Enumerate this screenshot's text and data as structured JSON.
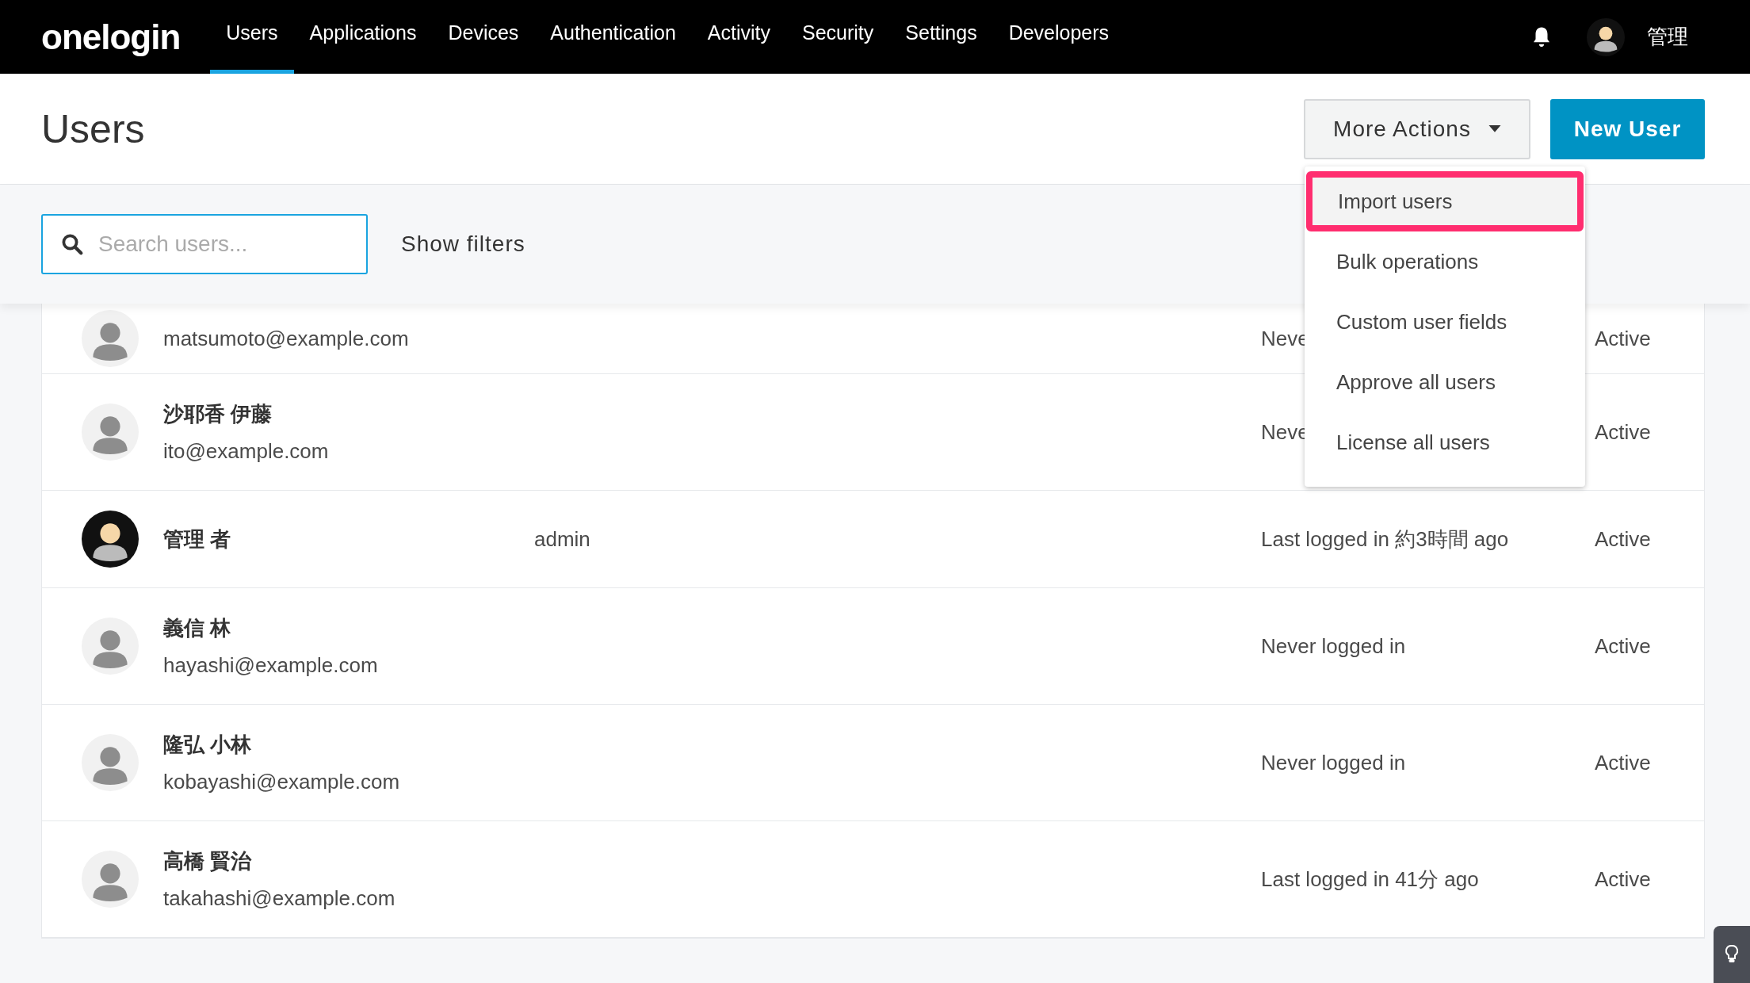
{
  "nav": {
    "logo": "onelogin",
    "items": [
      {
        "label": "Users",
        "selected": true
      },
      {
        "label": "Applications",
        "selected": false
      },
      {
        "label": "Devices",
        "selected": false
      },
      {
        "label": "Authentication",
        "selected": false
      },
      {
        "label": "Activity",
        "selected": false
      },
      {
        "label": "Security",
        "selected": false
      },
      {
        "label": "Settings",
        "selected": false
      },
      {
        "label": "Developers",
        "selected": false
      }
    ],
    "account": {
      "name": "管理",
      "kind": "illustrated"
    }
  },
  "header": {
    "title": "Users",
    "more_actions": "More Actions",
    "new_user": "New User"
  },
  "dropdown": {
    "items": [
      {
        "label": "Import users",
        "selected": true
      },
      {
        "label": "Bulk operations",
        "selected": false
      },
      {
        "label": "Custom user fields",
        "selected": false
      },
      {
        "label": "Approve all users",
        "selected": false
      },
      {
        "label": "License all users",
        "selected": false
      }
    ]
  },
  "filters": {
    "search": {
      "placeholder": "Search users..."
    },
    "show_filters": "Show filters"
  },
  "rows": [
    {
      "kind": "default",
      "email": "matsumoto@example.com",
      "last_login": "Neve",
      "status": "Active"
    },
    {
      "kind": "default",
      "name": "沙耶香 伊藤",
      "email": "ito@example.com",
      "last_login": "Neve",
      "status": "Active"
    },
    {
      "kind": "illustrated",
      "name": "管理 者",
      "username": "admin",
      "last_login": "Last logged in 約3時間 ago",
      "status": "Active"
    },
    {
      "kind": "default",
      "name": "義信 林",
      "email": "hayashi@example.com",
      "last_login": "Never logged in",
      "status": "Active"
    },
    {
      "kind": "default",
      "name": "隆弘 小林",
      "email": "kobayashi@example.com",
      "last_login": "Never logged in",
      "status": "Active"
    },
    {
      "kind": "default",
      "name": "高橋 賢治",
      "email": "takahashi@example.com",
      "last_login": "Last logged in 41分 ago",
      "status": "Active"
    }
  ]
}
